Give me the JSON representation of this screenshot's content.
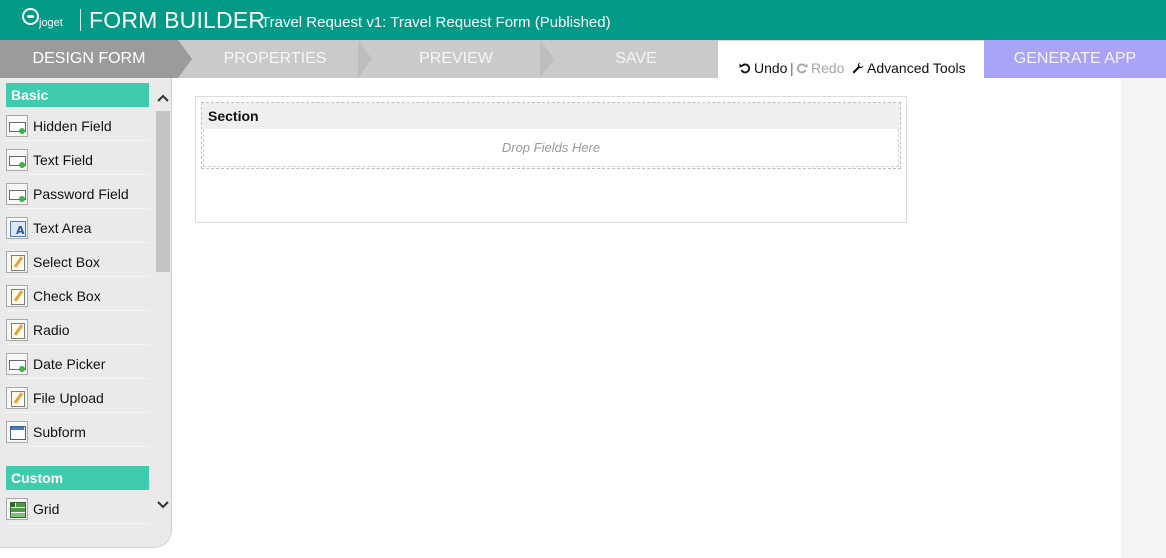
{
  "header": {
    "logo_text": "joget",
    "app_title": "FORM BUILDER",
    "form_subtitle": "Travel Request v1: Travel Request Form (Published)"
  },
  "steps": [
    "DESIGN FORM",
    "PROPERTIES",
    "PREVIEW",
    "SAVE"
  ],
  "toolbar": {
    "undo_label": "Undo",
    "separator": "|",
    "redo_label": "Redo",
    "advanced_tools_label": "Advanced Tools"
  },
  "generate_label": "GENERATE APP",
  "palette": {
    "basic_label": "Basic",
    "basic_items": [
      "Hidden Field",
      "Text Field",
      "Password Field",
      "Text Area",
      "Select Box",
      "Check Box",
      "Radio",
      "Date Picker",
      "File Upload",
      "Subform"
    ],
    "custom_label": "Custom",
    "custom_items": [
      "Grid"
    ]
  },
  "canvas": {
    "section_title": "Section",
    "drop_placeholder": "Drop Fields Here"
  },
  "colors": {
    "header": "#009a86",
    "step_active": "#9b9b9b",
    "step_inactive": "#cacaca",
    "generate_button": "#a9a4f5",
    "category_header": "#3fcbad"
  }
}
